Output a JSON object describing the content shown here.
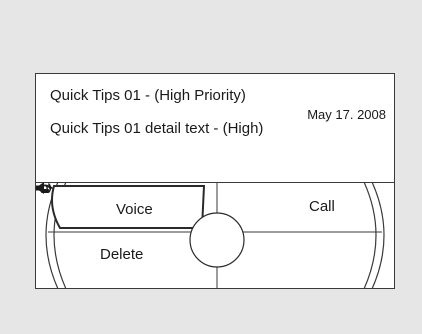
{
  "message": {
    "title": "Quick Tips 01 - (High Priority)",
    "date": "May 17. 2008",
    "detail": "Quick Tips 01 detail text - (High)"
  },
  "softkeys": {
    "voice_label": "Voice",
    "call_label": "Call",
    "delete_label": "Delete",
    "voice_icon": "speaker-icon",
    "call_icon": "phone-icon",
    "selected": "voice"
  }
}
